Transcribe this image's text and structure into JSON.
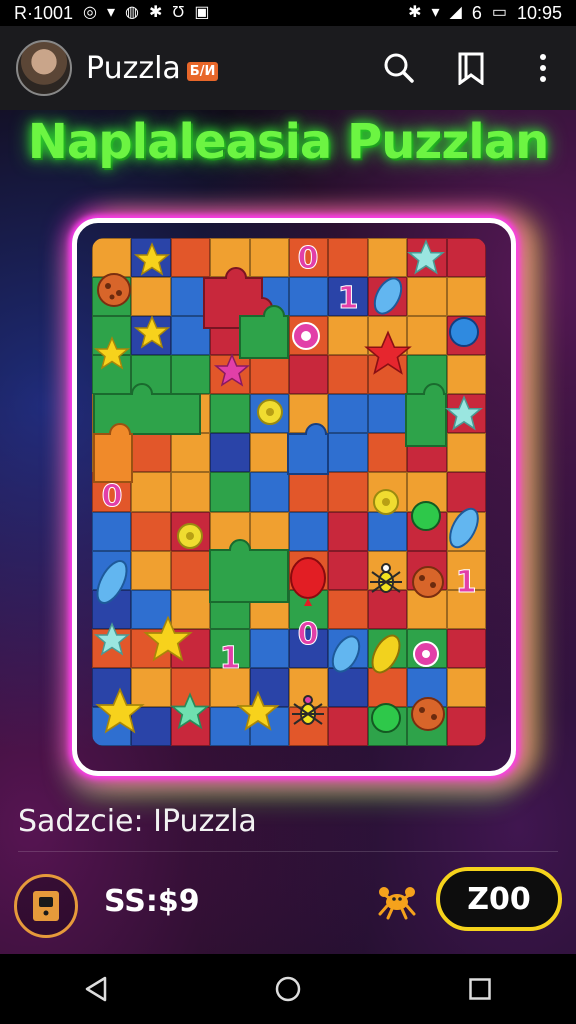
{
  "status_bar": {
    "carrier": "R·1001",
    "network_label": "6",
    "time": "10:95",
    "left_icons": [
      "chrome-icon",
      "wifi-icon",
      "messenger-icon",
      "bluetooth-icon",
      "alarm-icon",
      "image-icon"
    ],
    "right_icons": [
      "bluetooth-icon",
      "wifi-icon",
      "signal-icon",
      "battery-icon"
    ]
  },
  "app_bar": {
    "title": "Puzzla",
    "badge": "Б/И",
    "actions": [
      "search-icon",
      "bookmark-icon",
      "more-icon"
    ]
  },
  "game": {
    "headline": "Naplaleasia Puzzlan",
    "caption": "Sadzcie: IPuzzla",
    "score": "SS:$9",
    "zoo_button": "Z00",
    "board_labels": {
      "one": "1",
      "zero": "0"
    },
    "tile_colors": [
      "#f0a030",
      "#e2572a",
      "#2f6fd0",
      "#2ea34a",
      "#c8283c",
      "#2a44a8"
    ],
    "frame_colors": {
      "magenta": "#ff3cf0",
      "yellow": "#f5f23c",
      "green": "#6cf542"
    }
  },
  "nav_bar": {
    "icons": [
      "back-icon",
      "home-icon",
      "recents-icon"
    ]
  }
}
